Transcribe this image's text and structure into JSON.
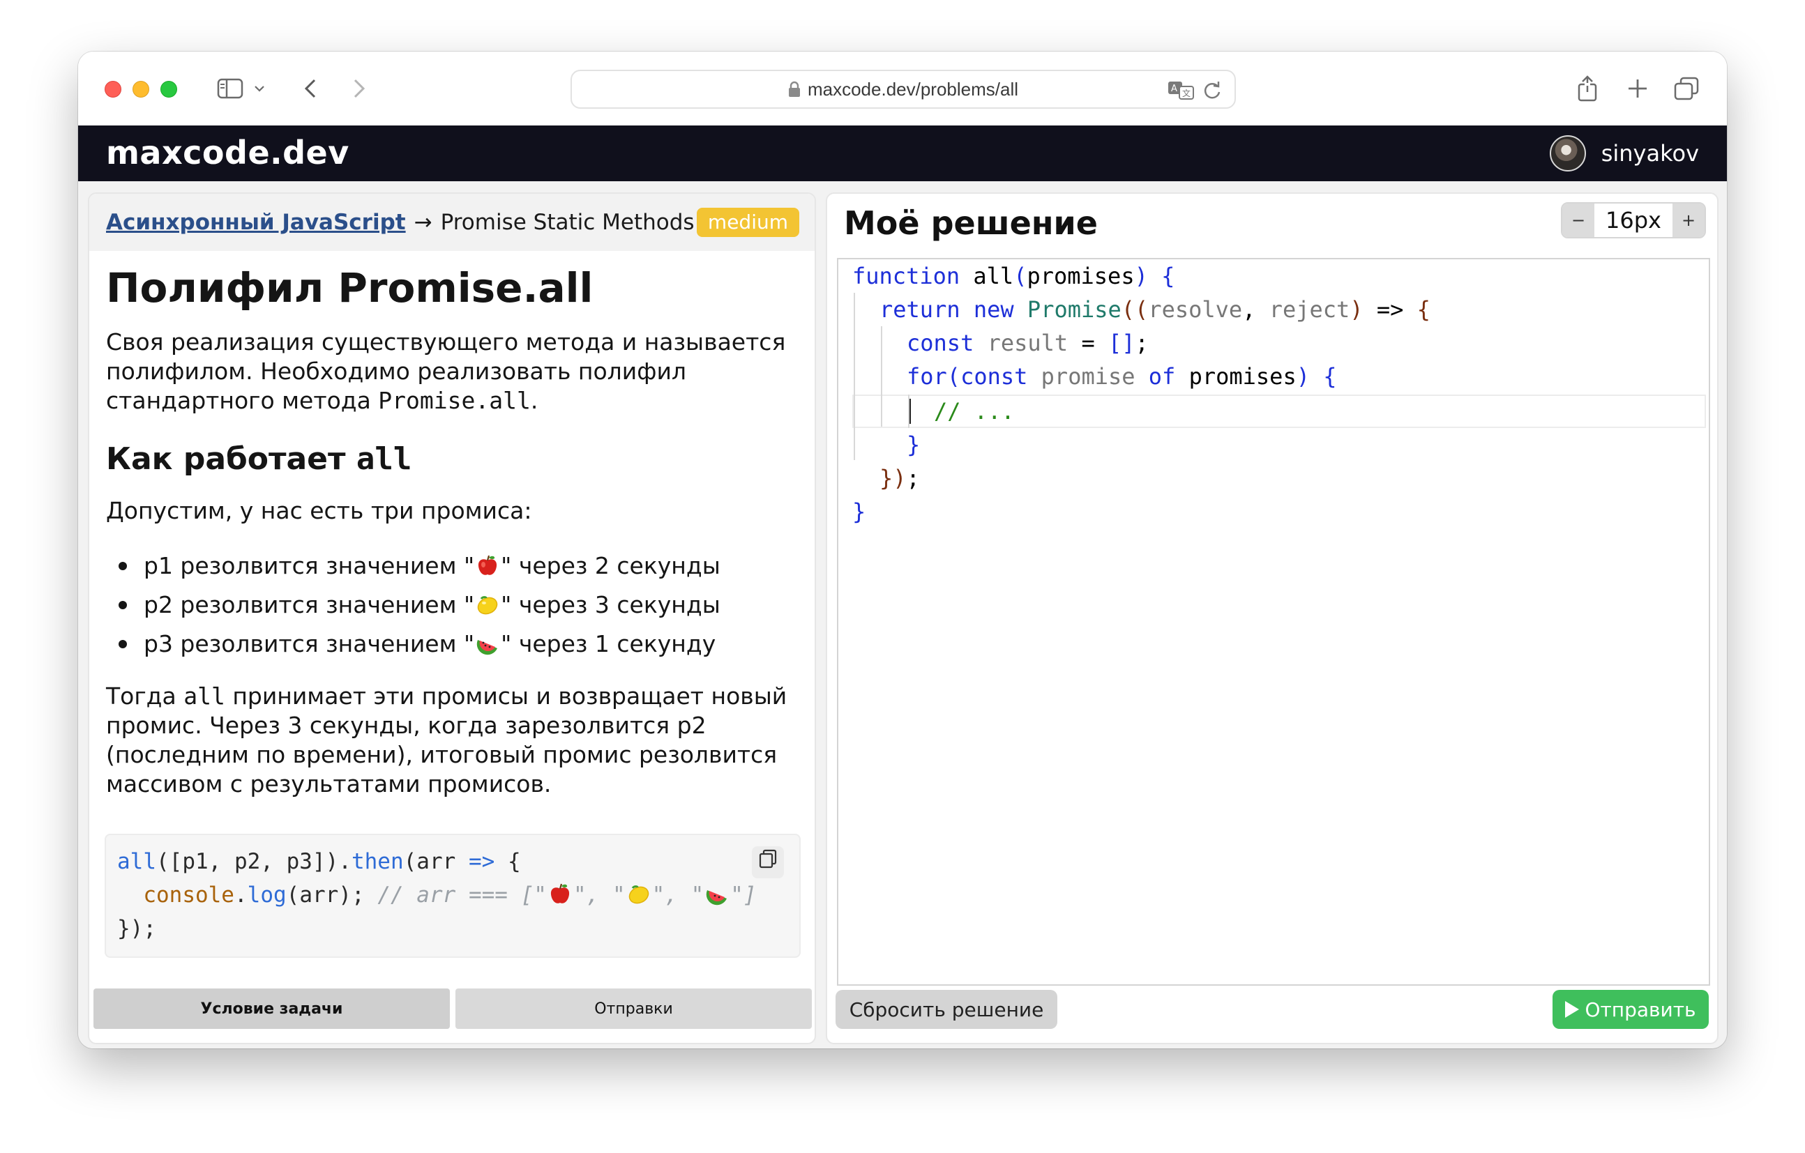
{
  "browser": {
    "url": "maxcode.dev/problems/all"
  },
  "site": {
    "logo": "maxcode.dev",
    "username": "sinyakov"
  },
  "problem": {
    "breadcrumb_link": "Асинхронный JavaScript",
    "breadcrumb_arrow": "→",
    "breadcrumb_current": "Promise Static Methods",
    "difficulty": "medium",
    "title": "Полифил Promise.all",
    "intro_part1": "Своя реализация существующего метода и называется полифилом. Необходимо реализовать полифил стандартного метода ",
    "intro_code": "Promise.all",
    "intro_part2": ".",
    "section_title_text": "Как работает ",
    "section_title_code": "all",
    "assume_text": "Допустим, у нас есть три промиса:",
    "list": [
      {
        "before": "p1 резолвится значением \"",
        "fruit": "apple",
        "after": "\" через 2 секунды"
      },
      {
        "before": "p2 резолвится значением \"",
        "fruit": "lemon",
        "after": "\" через 3 секунды"
      },
      {
        "before": "p3 резолвится значением \"",
        "fruit": "watermelon",
        "after": "\" через 1 секунду"
      }
    ],
    "then_part1": "Тогда ",
    "then_code": "all",
    "then_part2": " принимает эти промисы и возвращает новый промис. Через 3 секунды, когда зарезолвится p2 (последним по времени), итоговый промис резолвится массивом с результатами промисов.",
    "example": {
      "l1_a": "all",
      "l1_b": "([p1, p2, p3]).",
      "l1_c": "then",
      "l1_d": "(arr ",
      "l1_e": "=>",
      "l1_f": " {",
      "l2_a": "  ",
      "l2_b": "console",
      "l2_c": ".",
      "l2_d": "log",
      "l2_e": "(arr); ",
      "l2_f": "// arr === [\"",
      "l2_g": "\", \"",
      "l2_h": "\", \"",
      "l2_i": "\"]",
      "l3": "});"
    },
    "tabs": [
      "Условие задачи",
      "Отправки"
    ]
  },
  "solution": {
    "title": "Моё решение",
    "font_size": "16px",
    "minus": "−",
    "plus": "+",
    "code": {
      "l1": [
        "function",
        " all",
        "(",
        "promises",
        ")",
        " {"
      ],
      "l2": [
        "return",
        " new",
        " Promise",
        "((",
        "resolve",
        ", ",
        "reject",
        ")",
        " =>",
        " {"
      ],
      "l3": [
        "const",
        " result",
        " = ",
        "[]",
        ";"
      ],
      "l4": [
        "for",
        "(",
        "const",
        " promise",
        " of",
        " promises",
        ")",
        " {"
      ],
      "l5": "// ...",
      "l6": "}",
      "l7": [
        "}",
        ")",
        ";"
      ],
      "l8": "}"
    },
    "reset_label": "Сбросить решение",
    "submit_label": "Отправить"
  },
  "icons": [
    "sidebar-icon",
    "chevron-down-icon",
    "back-icon",
    "forward-icon",
    "lock-icon",
    "translate-icon",
    "reload-icon",
    "share-icon",
    "new-tab-icon",
    "tabs-overview-icon",
    "copy-icon",
    "play-icon"
  ],
  "colors": {
    "header_bg": "#10101c",
    "badge": "#f3c433",
    "submit": "#3fbf5c",
    "keyword": "#1d2fd8",
    "comment": "#2a8a1a"
  }
}
